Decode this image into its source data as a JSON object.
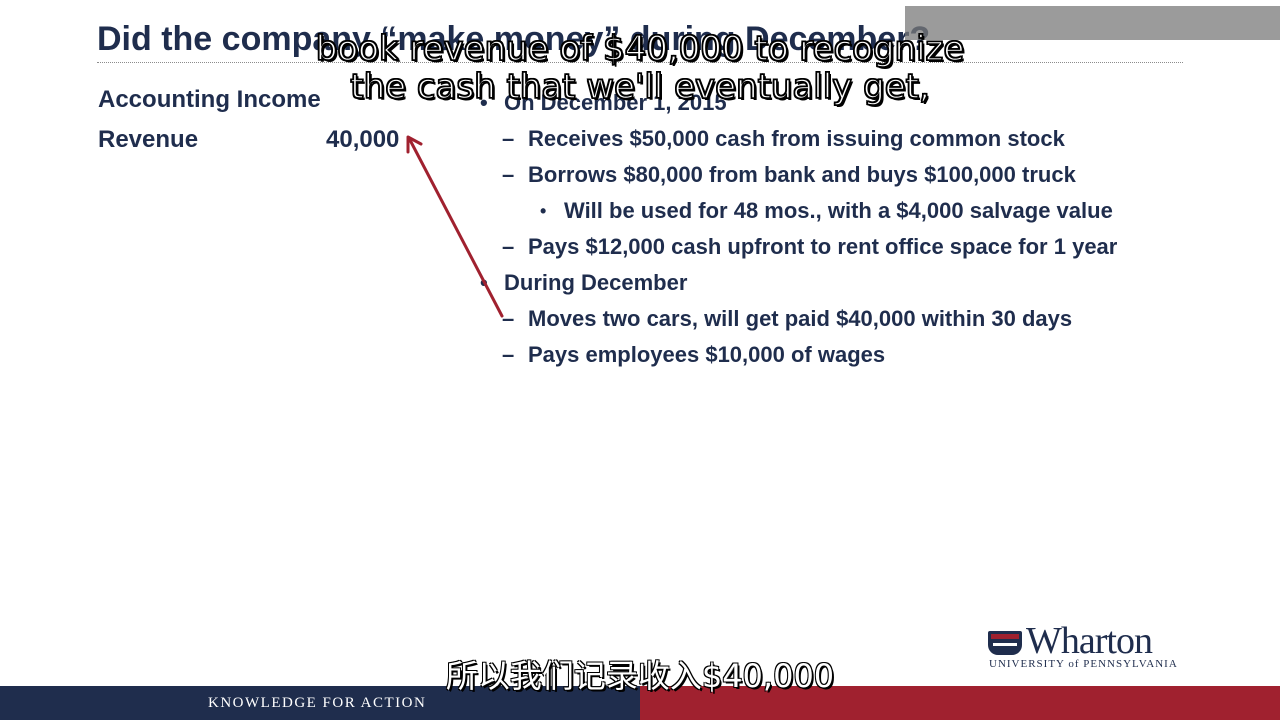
{
  "slide": {
    "title": "Did the company “make money” during December?",
    "left": {
      "heading": "Accounting Income",
      "revenue_label": "Revenue",
      "revenue_value": "40,000"
    },
    "right": {
      "bullet1": "On December 1, 2015",
      "items1": [
        "Receives $50,000 cash from issuing common stock",
        "Borrows $80,000 from bank and buys $100,000 truck"
      ],
      "sub1": "Will be used for 48 mos., with a $4,000 salvage value",
      "item_rent": "Pays $12,000 cash upfront to rent office space for 1 year",
      "bullet2": "During December",
      "items2": [
        "Moves two cars, will get paid $40,000 within 30 days",
        "Pays employees $10,000 of wages"
      ]
    },
    "bullet_symbol": "•",
    "dash_symbol": "–",
    "sub_symbol": "•"
  },
  "subtitles": {
    "english_line1": "book revenue of $40,000 to recognize",
    "english_line2": "the cash that we'll eventually get,",
    "chinese": "所以我们记录收入$40,000"
  },
  "logo": {
    "word": "Wharton",
    "sub": "UNIVERSITY of PENNSYLVANIA"
  },
  "footer": {
    "text": "KNOWLEDGE FOR ACTION"
  },
  "colors": {
    "navy": "#1f2d4d",
    "crimson": "#a0212f",
    "arrow": "#a0212f"
  }
}
